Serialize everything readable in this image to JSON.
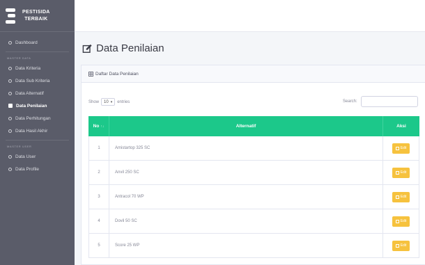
{
  "brand": {
    "line1": "PESTISIDA",
    "line2": "TERBAIK"
  },
  "sidebar": {
    "items": [
      {
        "label": "Dashboard"
      },
      {
        "label": "Data Kriteria"
      },
      {
        "label": "Data Sub Kriteria"
      },
      {
        "label": "Data Alternatif"
      },
      {
        "label": "Data Penilaian",
        "active": true
      },
      {
        "label": "Data Perhitungan"
      },
      {
        "label": "Data Hasil Akhir"
      },
      {
        "label": "Data User"
      },
      {
        "label": "Data Profile"
      }
    ],
    "section_master": "MASTER DATA",
    "section_user": "MASTER USER"
  },
  "page": {
    "title": "Data Penilaian"
  },
  "card": {
    "header": "Daftar Data Penilaian"
  },
  "controls": {
    "show_label": "Show",
    "entries_value": "10",
    "entries_label": "entries",
    "search_label": "Search:"
  },
  "table": {
    "columns": {
      "no": "No",
      "alternatif": "Alternatif",
      "aksi": "Aksi"
    },
    "rows": [
      {
        "no": "1",
        "alternatif": "Amistartop 325 SC"
      },
      {
        "no": "2",
        "alternatif": "Anvil 250 SC"
      },
      {
        "no": "3",
        "alternatif": "Antracol 70 WP"
      },
      {
        "no": "4",
        "alternatif": "Dovil 50 SC"
      },
      {
        "no": "5",
        "alternatif": "Score 25 WP"
      }
    ],
    "action_label": "Edit"
  },
  "colors": {
    "sidebar": "#5a5c69",
    "table_header": "#1cc88a",
    "edit_button": "#f6c23e"
  }
}
